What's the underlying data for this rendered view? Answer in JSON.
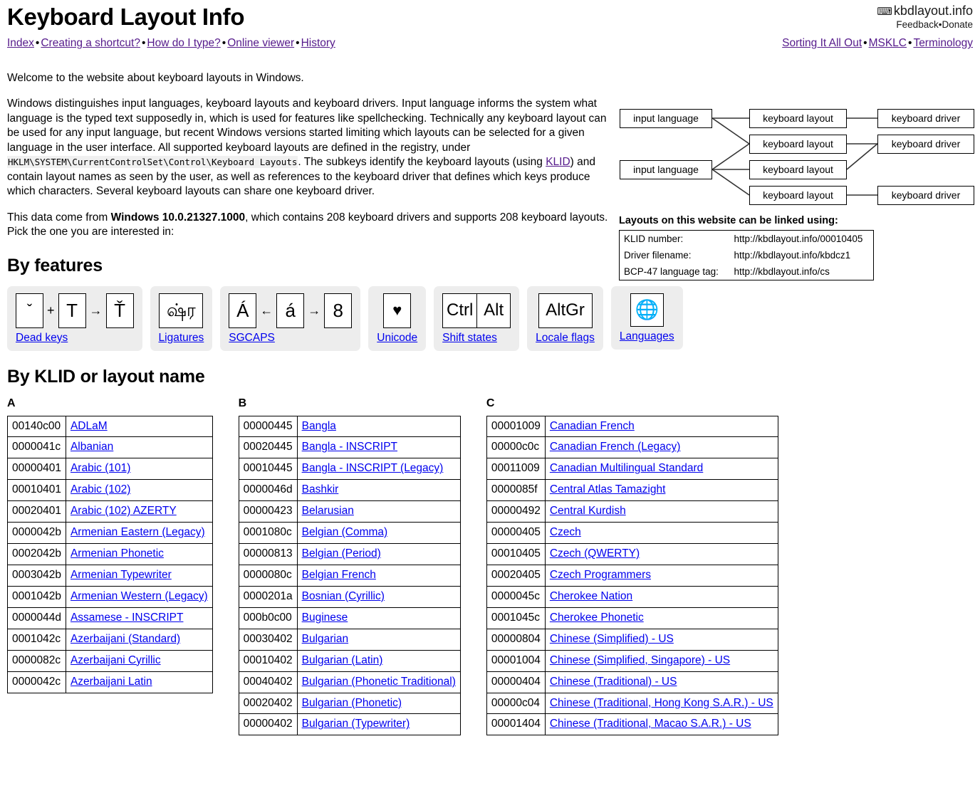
{
  "header": {
    "title": "Keyboard Layout Info",
    "brand": {
      "icon": "keyboard-icon",
      "name": "kbdlayout.info",
      "feedback": "Feedback",
      "donate": "Donate",
      "separator": "•"
    },
    "nav_left": [
      "Index",
      "Creating a shortcut?",
      "How do I type?",
      "Online viewer",
      "History"
    ],
    "nav_right": [
      "Sorting It All Out",
      "MSKLC",
      "Terminology"
    ],
    "separator": "•"
  },
  "intro": {
    "p1": "Welcome to the website about keyboard layouts in Windows.",
    "p2_a": "Windows distinguishes input languages, keyboard layouts and keyboard drivers. Input language informs the system what language is the typed text supposedly in, which is used for features like spellchecking. Technically any keyboard layout can be used for any input language, but recent Windows versions started limiting which layouts can be selected for a given language in the user interface. All supported keyboard layouts are defined in the registry, under ",
    "registry_path": "HKLM\\SYSTEM\\CurrentControlSet\\Control\\Keyboard Layouts",
    "p2_b": ". The subkeys identify the keyboard layouts (using ",
    "klid_link": "KLID",
    "p2_c": ") and contain layout names as seen by the user, as well as references to the keyboard driver that defines which keys produce which characters. Several keyboard layouts can share one keyboard driver.",
    "p3_a": "This data come from ",
    "windows_version": "Windows 10.0.21327.1000",
    "p3_b": ", which contains 208 keyboard drivers and supports 208 keyboard layouts. Pick the one you are interested in:"
  },
  "diagram": {
    "input_language": "input language",
    "keyboard_layout": "keyboard layout",
    "keyboard_driver": "keyboard driver",
    "inputs": [
      "input language",
      "input language"
    ],
    "layouts": [
      "keyboard layout",
      "keyboard layout",
      "keyboard layout",
      "keyboard layout"
    ],
    "drivers": [
      "keyboard driver",
      "keyboard driver",
      "keyboard driver"
    ]
  },
  "linking": {
    "heading": "Layouts on this website can be linked using:",
    "rows": [
      {
        "key": "KLID number:",
        "value": "http://kbdlayout.info/00010405"
      },
      {
        "key": "Driver filename:",
        "value": "http://kbdlayout.info/kbdcz1"
      },
      {
        "key": "BCP-47 language tag:",
        "value": "http://kbdlayout.info/cs"
      }
    ]
  },
  "features": {
    "heading": "By features",
    "cards": [
      {
        "label": "Dead keys",
        "keys": [
          "ˇ",
          "T",
          "Ť"
        ],
        "ops": [
          "+",
          "→"
        ],
        "kind": "deadkeys"
      },
      {
        "label": "Ligatures",
        "keys": [
          "ஷ்ர"
        ],
        "ops": [],
        "kind": "ligature"
      },
      {
        "label": "SGCAPS",
        "keys": [
          "Á",
          "á",
          "8"
        ],
        "ops": [
          "←",
          "→"
        ],
        "kind": "sgcaps"
      },
      {
        "label": "Unicode",
        "keys": [
          "♥"
        ],
        "ops": [],
        "kind": "unicode"
      },
      {
        "label": "Shift states",
        "keys": [
          "Ctrl",
          "Alt"
        ],
        "ops": [],
        "kind": "shiftstates"
      },
      {
        "label": "Locale flags",
        "keys": [
          "AltGr"
        ],
        "ops": [],
        "kind": "altgr"
      },
      {
        "label": "Languages",
        "keys": [
          "🌐"
        ],
        "ops": [],
        "kind": "languages"
      }
    ]
  },
  "klid_section": {
    "heading": "By KLID or layout name",
    "columns": [
      {
        "letter": "A",
        "rows": [
          {
            "klid": "00140c00",
            "name": "ADLaM"
          },
          {
            "klid": "0000041c",
            "name": "Albanian"
          },
          {
            "klid": "00000401",
            "name": "Arabic (101)"
          },
          {
            "klid": "00010401",
            "name": "Arabic (102)"
          },
          {
            "klid": "00020401",
            "name": "Arabic (102) AZERTY"
          },
          {
            "klid": "0000042b",
            "name": "Armenian Eastern (Legacy)"
          },
          {
            "klid": "0002042b",
            "name": "Armenian Phonetic"
          },
          {
            "klid": "0003042b",
            "name": "Armenian Typewriter"
          },
          {
            "klid": "0001042b",
            "name": "Armenian Western (Legacy)"
          },
          {
            "klid": "0000044d",
            "name": "Assamese - INSCRIPT"
          },
          {
            "klid": "0001042c",
            "name": "Azerbaijani (Standard)"
          },
          {
            "klid": "0000082c",
            "name": "Azerbaijani Cyrillic"
          },
          {
            "klid": "0000042c",
            "name": "Azerbaijani Latin"
          }
        ]
      },
      {
        "letter": "B",
        "rows": [
          {
            "klid": "00000445",
            "name": "Bangla"
          },
          {
            "klid": "00020445",
            "name": "Bangla - INSCRIPT"
          },
          {
            "klid": "00010445",
            "name": "Bangla - INSCRIPT (Legacy)"
          },
          {
            "klid": "0000046d",
            "name": "Bashkir"
          },
          {
            "klid": "00000423",
            "name": "Belarusian"
          },
          {
            "klid": "0001080c",
            "name": "Belgian (Comma)"
          },
          {
            "klid": "00000813",
            "name": "Belgian (Period)"
          },
          {
            "klid": "0000080c",
            "name": "Belgian French"
          },
          {
            "klid": "0000201a",
            "name": "Bosnian (Cyrillic)"
          },
          {
            "klid": "000b0c00",
            "name": "Buginese"
          },
          {
            "klid": "00030402",
            "name": "Bulgarian"
          },
          {
            "klid": "00010402",
            "name": "Bulgarian (Latin)"
          },
          {
            "klid": "00040402",
            "name": "Bulgarian (Phonetic Traditional)"
          },
          {
            "klid": "00020402",
            "name": "Bulgarian (Phonetic)"
          },
          {
            "klid": "00000402",
            "name": "Bulgarian (Typewriter)"
          }
        ]
      },
      {
        "letter": "C",
        "rows": [
          {
            "klid": "00001009",
            "name": "Canadian French"
          },
          {
            "klid": "00000c0c",
            "name": "Canadian French (Legacy)"
          },
          {
            "klid": "00011009",
            "name": "Canadian Multilingual Standard"
          },
          {
            "klid": "0000085f",
            "name": "Central Atlas Tamazight"
          },
          {
            "klid": "00000492",
            "name": "Central Kurdish"
          },
          {
            "klid": "00000405",
            "name": "Czech"
          },
          {
            "klid": "00010405",
            "name": "Czech (QWERTY)"
          },
          {
            "klid": "00020405",
            "name": "Czech Programmers"
          },
          {
            "klid": "0000045c",
            "name": "Cherokee Nation"
          },
          {
            "klid": "0001045c",
            "name": "Cherokee Phonetic"
          },
          {
            "klid": "00000804",
            "name": "Chinese (Simplified) - US"
          },
          {
            "klid": "00001004",
            "name": "Chinese (Simplified, Singapore) - US"
          },
          {
            "klid": "00000404",
            "name": "Chinese (Traditional) - US"
          },
          {
            "klid": "00000c04",
            "name": "Chinese (Traditional, Hong Kong S.A.R.) - US"
          },
          {
            "klid": "00001404",
            "name": "Chinese (Traditional, Macao S.A.R.) - US"
          }
        ]
      }
    ]
  },
  "colors": {
    "link": "#0000ee",
    "visited": "#551a8b",
    "card_bg": "#ededed",
    "code_bg": "#f0f0f0"
  }
}
